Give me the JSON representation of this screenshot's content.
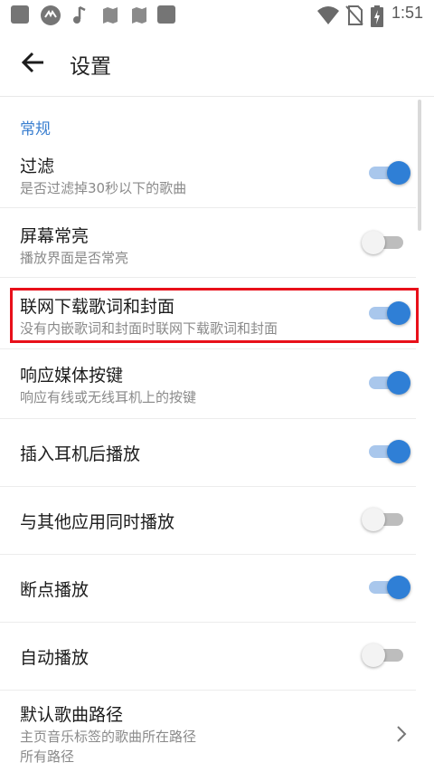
{
  "statusbar": {
    "time": "1:51",
    "icons": [
      "app-square-icon",
      "cast-icon",
      "music-note-icon",
      "map-icon",
      "map-icon",
      "app-square-icon",
      "wifi-icon",
      "no-sim-icon",
      "battery-charging-icon"
    ]
  },
  "appbar": {
    "title": "设置"
  },
  "section": {
    "general": "常规"
  },
  "settings": [
    {
      "title": "过滤",
      "subtitle": "是否过滤掉30秒以下的歌曲",
      "enabled": true
    },
    {
      "title": "屏幕常亮",
      "subtitle": "播放界面是否常亮",
      "enabled": false
    },
    {
      "title": "联网下载歌词和封面",
      "subtitle": "没有内嵌歌词和封面时联网下载歌词和封面",
      "enabled": true
    },
    {
      "title": "响应媒体按键",
      "subtitle": "响应有线或无线耳机上的按键",
      "enabled": true
    },
    {
      "title": "插入耳机后播放",
      "enabled": true
    },
    {
      "title": "与其他应用同时播放",
      "enabled": false
    },
    {
      "title": "断点播放",
      "enabled": true
    },
    {
      "title": "自动播放",
      "enabled": false
    },
    {
      "title": "默认歌曲路径",
      "subtitle": "主页音乐标签的歌曲所在路径",
      "subtitle2": "所有路径"
    }
  ],
  "colors": {
    "accent": "#2f7fd6",
    "section_header": "#3a7fd0",
    "highlight_border": "#e8101a"
  }
}
